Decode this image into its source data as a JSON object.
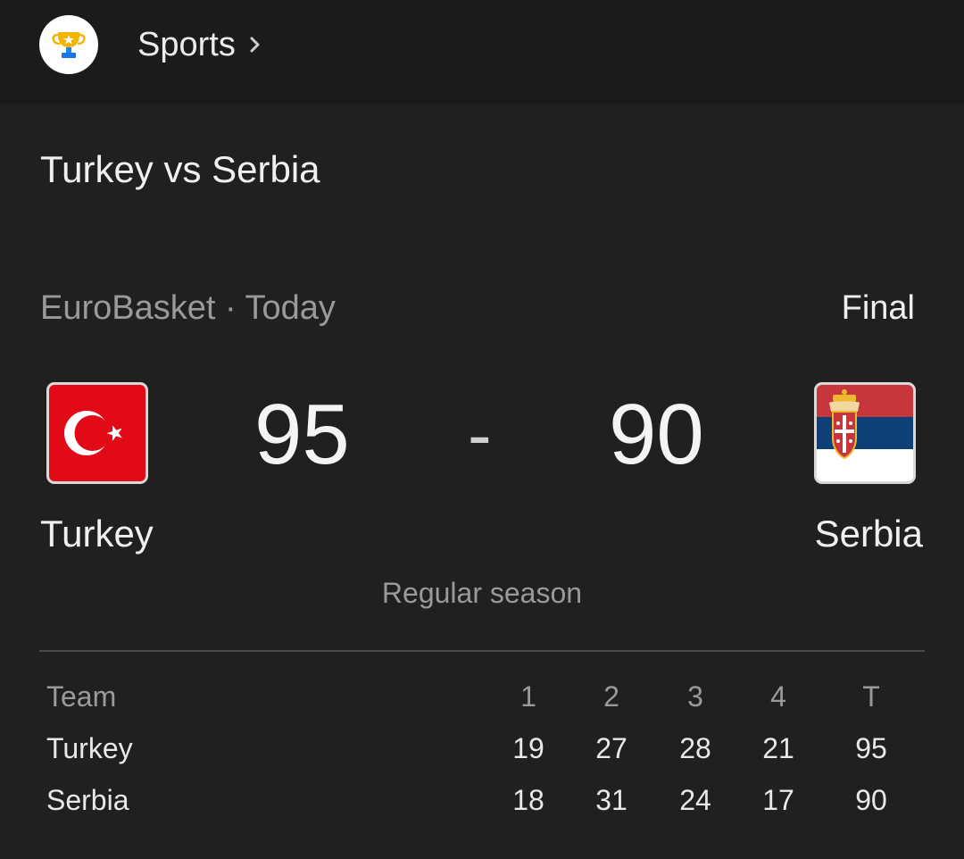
{
  "header": {
    "icon": "trophy-icon",
    "label": "Sports",
    "chevron": "chevron-right-icon"
  },
  "match": {
    "title": "Turkey vs Serbia",
    "competition": "EuroBasket · Today",
    "status": "Final",
    "home": {
      "name": "Turkey",
      "score": "95",
      "flag": "turkey-flag-icon"
    },
    "separator": "-",
    "away": {
      "name": "Serbia",
      "score": "90",
      "flag": "serbia-flag-icon"
    },
    "stage": "Regular season"
  },
  "boxscore": {
    "headers": [
      "Team",
      "1",
      "2",
      "3",
      "4",
      "T"
    ],
    "rows": [
      {
        "team": "Turkey",
        "q1": "19",
        "q2": "27",
        "q3": "28",
        "q4": "21",
        "total": "95"
      },
      {
        "team": "Serbia",
        "q1": "18",
        "q2": "31",
        "q3": "24",
        "q4": "17",
        "total": "90"
      }
    ]
  },
  "colors": {
    "background": "#202020",
    "topbar": "#1b1b1b",
    "muted_text": "#9a9a9a",
    "turkey_red": "#e30a17",
    "serbia_red": "#c6363c",
    "serbia_blue": "#0c4076"
  }
}
